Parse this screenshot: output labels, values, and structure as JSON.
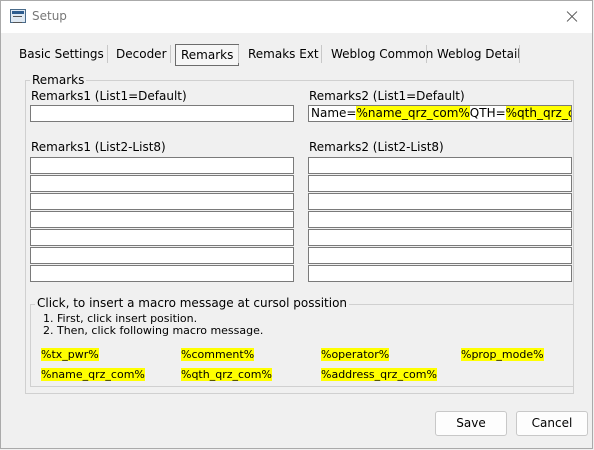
{
  "window": {
    "title": "Setup"
  },
  "tabs": [
    {
      "label": "Basic Settings"
    },
    {
      "label": "Decoder"
    },
    {
      "label": "Remarks",
      "active": true
    },
    {
      "label": "Remaks Ext"
    },
    {
      "label": "Weblog Common"
    },
    {
      "label": "Weblog Detail"
    }
  ],
  "remarks_group": {
    "label": "Remarks",
    "remarks1_default_label": "Remarks1 (List1=Default)",
    "remarks1_default_value": "",
    "remarks2_default_label": "Remarks2 (List1=Default)",
    "remarks2_default_value": {
      "p1": "Name=",
      "m1": "%name_qrz_com%",
      "p2": "QTH=",
      "m2": "%qth_qrz_com%"
    },
    "remarks1_list_label": "Remarks1 (List2-List8)",
    "remarks2_list_label": "Remarks2 (List2-List8)",
    "remarks1_list": [
      "",
      "",
      "",
      "",
      "",
      "",
      ""
    ],
    "remarks2_list": [
      "",
      "",
      "",
      "",
      "",
      "",
      ""
    ]
  },
  "macro_group": {
    "label": "Click, to insert a macro message at cursol possition",
    "instruction1": "1. First, click insert position.",
    "instruction2": "2. Then, click following macro message.",
    "macros_row1": [
      "%tx_pwr%",
      "%comment%",
      "%operator%",
      "%prop_mode%"
    ],
    "macros_row2": [
      "%name_qrz_com%",
      "%qth_qrz_com%",
      "%address_qrz_com%"
    ]
  },
  "buttons": {
    "save": "Save",
    "cancel": "Cancel"
  },
  "colors": {
    "macro_highlight": "#ffff00"
  },
  "icons": {
    "app": "setup-window-icon",
    "close": "close-icon"
  }
}
